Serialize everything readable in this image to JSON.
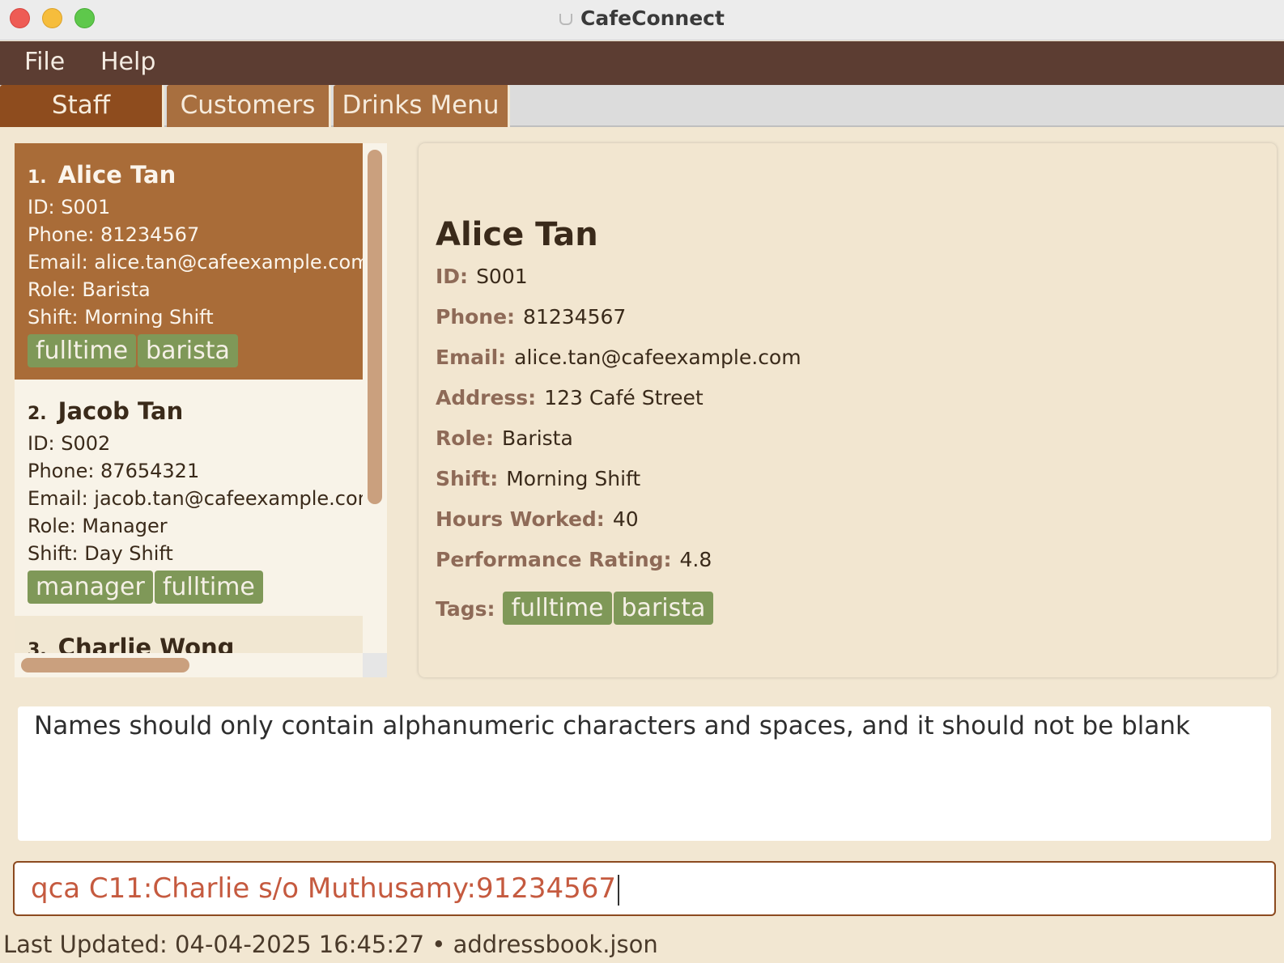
{
  "window": {
    "title": "CafeConnect",
    "icon": "coffee-cup-icon"
  },
  "menu": {
    "items": [
      "File",
      "Help"
    ]
  },
  "tabs": [
    {
      "label": "Staff",
      "active": true
    },
    {
      "label": "Customers",
      "active": false
    },
    {
      "label": "Drinks Menu",
      "active": false
    }
  ],
  "staff_list": [
    {
      "index": "1.",
      "name": "Alice Tan",
      "id": "ID: S001",
      "phone": "Phone: 81234567",
      "email": "Email: alice.tan@cafeexample.com",
      "role": "Role: Barista",
      "shift": "Shift: Morning Shift",
      "tags": [
        "fulltime",
        "barista"
      ],
      "selected": true
    },
    {
      "index": "2.",
      "name": "Jacob Tan",
      "id": "ID: S002",
      "phone": "Phone: 87654321",
      "email": "Email: jacob.tan@cafeexample.com",
      "role": "Role: Manager",
      "shift": "Shift: Day Shift",
      "tags": [
        "manager",
        "fulltime"
      ],
      "selected": false
    },
    {
      "index": "3.",
      "name": "Charlie Wong"
    }
  ],
  "detail": {
    "name": "Alice Tan",
    "fields": [
      {
        "label": "ID:",
        "value": "S001"
      },
      {
        "label": "Phone:",
        "value": "81234567"
      },
      {
        "label": "Email:",
        "value": "alice.tan@cafeexample.com"
      },
      {
        "label": "Address:",
        "value": "123 Café Street"
      },
      {
        "label": "Role:",
        "value": "Barista"
      },
      {
        "label": "Shift:",
        "value": "Morning Shift"
      },
      {
        "label": "Hours Worked:",
        "value": "40"
      },
      {
        "label": "Performance Rating:",
        "value": "4.8"
      }
    ],
    "tags_label": "Tags:",
    "tags": [
      "fulltime",
      "barista"
    ]
  },
  "result_message": "Names should only contain alphanumeric characters and spaces, and it should not be blank",
  "command_input": {
    "value": "qca C11:Charlie s/o Muthusamy:91234567"
  },
  "status_bar": {
    "text": "Last Updated: 04-04-2025 16:45:27 • addressbook.json"
  },
  "colors": {
    "menubar": "#5c3d32",
    "tab_active": "#8e4c1e",
    "tab": "#a86f3f",
    "selected_card": "#a96c38",
    "tag": "#7f9858",
    "command_text": "#c55a3f"
  }
}
